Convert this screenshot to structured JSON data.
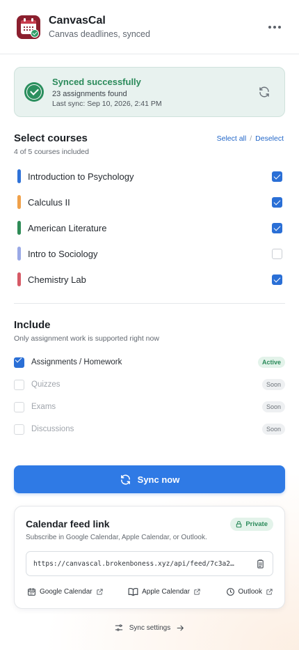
{
  "header": {
    "title": "CanvasCal",
    "subtitle": "Canvas deadlines, synced",
    "icon": "calendar-app-icon",
    "more_icon": "more-horizontal-icon"
  },
  "status": {
    "title": "Synced successfully",
    "count_text": "23 assignments found",
    "last_sync": "Last sync: Sep 10, 2026, 2:41 PM",
    "color": "#2a8a5a"
  },
  "courses": {
    "title": "Select courses",
    "subtitle": "4 of 5 courses included",
    "select_all": "Select all",
    "separator": "/",
    "deselect": "Deselect",
    "items": [
      {
        "name": "Introduction to Psychology",
        "color": "#2f72d8",
        "checked": true
      },
      {
        "name": "Calculus II",
        "color": "#f0a14a",
        "checked": true
      },
      {
        "name": "American Literature",
        "color": "#2e8b57",
        "checked": true
      },
      {
        "name": "Intro to Sociology",
        "color": "#9aa9e6",
        "checked": false
      },
      {
        "name": "Chemistry Lab",
        "color": "#d65a66",
        "checked": true
      }
    ]
  },
  "include": {
    "title": "Include",
    "subtitle": "Only assignment work is supported right now",
    "items": [
      {
        "label": "Assignments / Homework",
        "badge": "Active",
        "checked": true
      },
      {
        "label": "Quizzes",
        "badge": "Soon",
        "checked": false
      },
      {
        "label": "Exams",
        "badge": "Soon",
        "checked": false
      },
      {
        "label": "Discussions",
        "badge": "Soon",
        "checked": false
      }
    ]
  },
  "sync_button": {
    "label": "Sync now",
    "color": "#2f7ae5"
  },
  "feed": {
    "title": "Calendar feed link",
    "subtitle": "Subscribe in Google Calendar, Apple Calendar, or Outlook.",
    "badge": "Private",
    "url": "https://canvascal.brokenboness.xyz/api/feed/7c3a2…",
    "links": [
      "Google Calendar",
      "Apple Calendar",
      "Outlook"
    ]
  },
  "footer": {
    "settings_label": "Sync settings"
  }
}
